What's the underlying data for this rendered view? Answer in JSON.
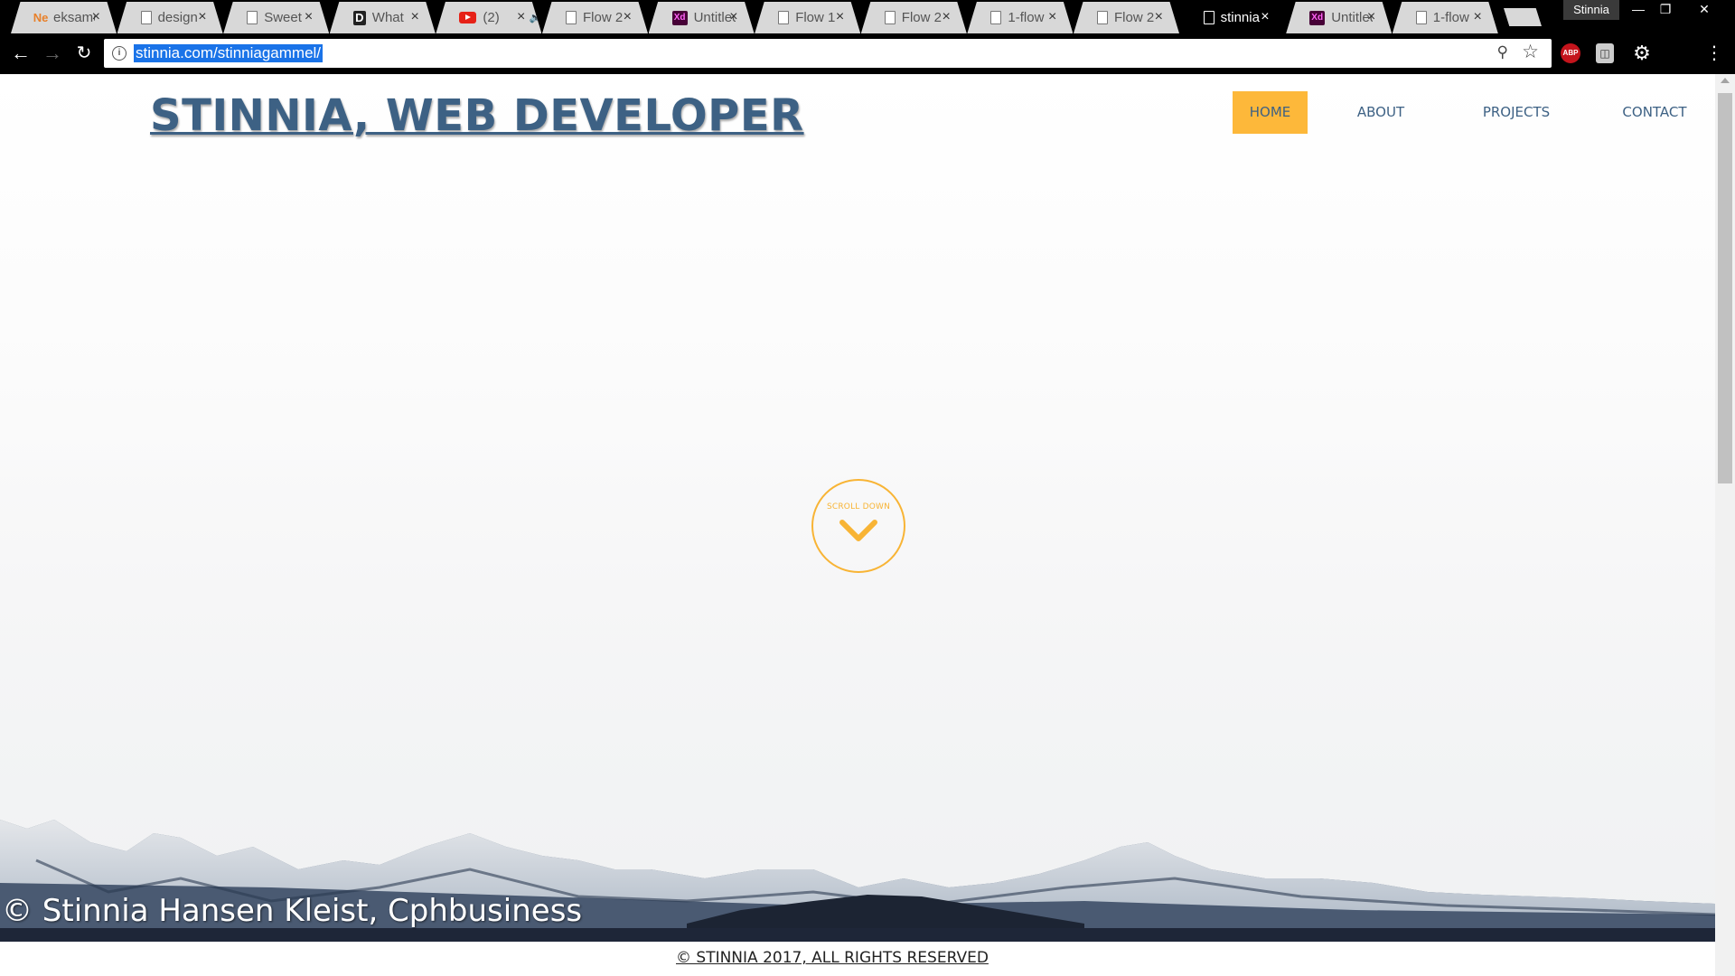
{
  "browser": {
    "tabs": [
      {
        "title": "eksamen",
        "icon": "orange-logo-icon",
        "active": false
      },
      {
        "title": "design",
        "icon": "document-icon",
        "active": false
      },
      {
        "title": "Sweet",
        "icon": "document-icon",
        "active": false
      },
      {
        "title": "What",
        "icon": "dark-logo-icon",
        "active": false
      },
      {
        "title": "(2)",
        "icon": "youtube-icon",
        "active": false,
        "audio": true
      },
      {
        "title": "Flow 2",
        "icon": "document-icon",
        "active": false
      },
      {
        "title": "Untitled",
        "icon": "adobe-xd-icon",
        "active": false
      },
      {
        "title": "Flow 1",
        "icon": "document-icon",
        "active": false
      },
      {
        "title": "Flow 2",
        "icon": "document-icon",
        "active": false
      },
      {
        "title": "1-flow",
        "icon": "document-icon",
        "active": false
      },
      {
        "title": "Flow 2",
        "icon": "document-icon",
        "active": false
      },
      {
        "title": "stinnia",
        "icon": "document-icon",
        "active": true
      },
      {
        "title": "Untitled",
        "icon": "adobe-xd-icon",
        "active": false
      },
      {
        "title": "1-flow",
        "icon": "document-icon",
        "active": false
      }
    ],
    "profile_name": "Stinnia",
    "url": "stinnia.com/stinniagammel/",
    "extensions": {
      "abp_label": "ABP"
    }
  },
  "page": {
    "site_title": "STINNIA, WEB DEVELOPER",
    "nav": [
      {
        "label": "HOME",
        "active": true
      },
      {
        "label": "ABOUT",
        "active": false
      },
      {
        "label": "PROJECTS",
        "active": false
      },
      {
        "label": "CONTACT",
        "active": false
      }
    ],
    "scroll_down_label": "SCROLL DOWN",
    "photo_credit": "© Stinnia Hansen Kleist, Cphbusiness",
    "footer_text": "© STINNIA 2017, ALL RIGHTS RESERVED"
  },
  "colors": {
    "accent": "#fdb83a",
    "brand_blue": "#3d6184",
    "url_highlight": "#1a73e8"
  }
}
